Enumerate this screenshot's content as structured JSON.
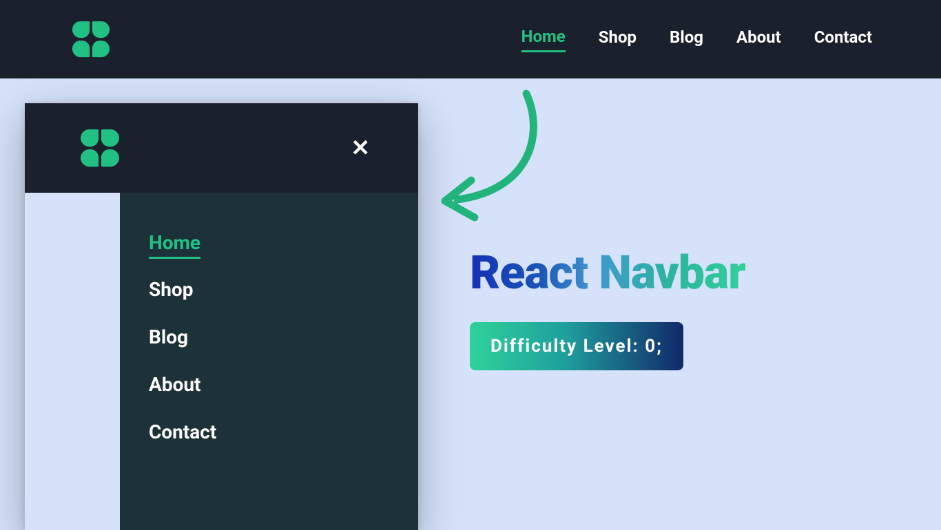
{
  "nav": {
    "items": [
      "Home",
      "Shop",
      "Blog",
      "About",
      "Contact"
    ],
    "activeIndex": 0
  },
  "mobileMenu": {
    "items": [
      "Home",
      "Shop",
      "Blog",
      "About",
      "Contact"
    ],
    "activeIndex": 0
  },
  "hero": {
    "titleWord1": "React",
    "titleWord2": "Navbar",
    "badge": "Difficulty Level: 0;"
  },
  "colors": {
    "accent": "#22c084",
    "darkNavy": "#1b202d",
    "panelTeal": "#1d3139",
    "pageBg": "#d5e2fa"
  }
}
